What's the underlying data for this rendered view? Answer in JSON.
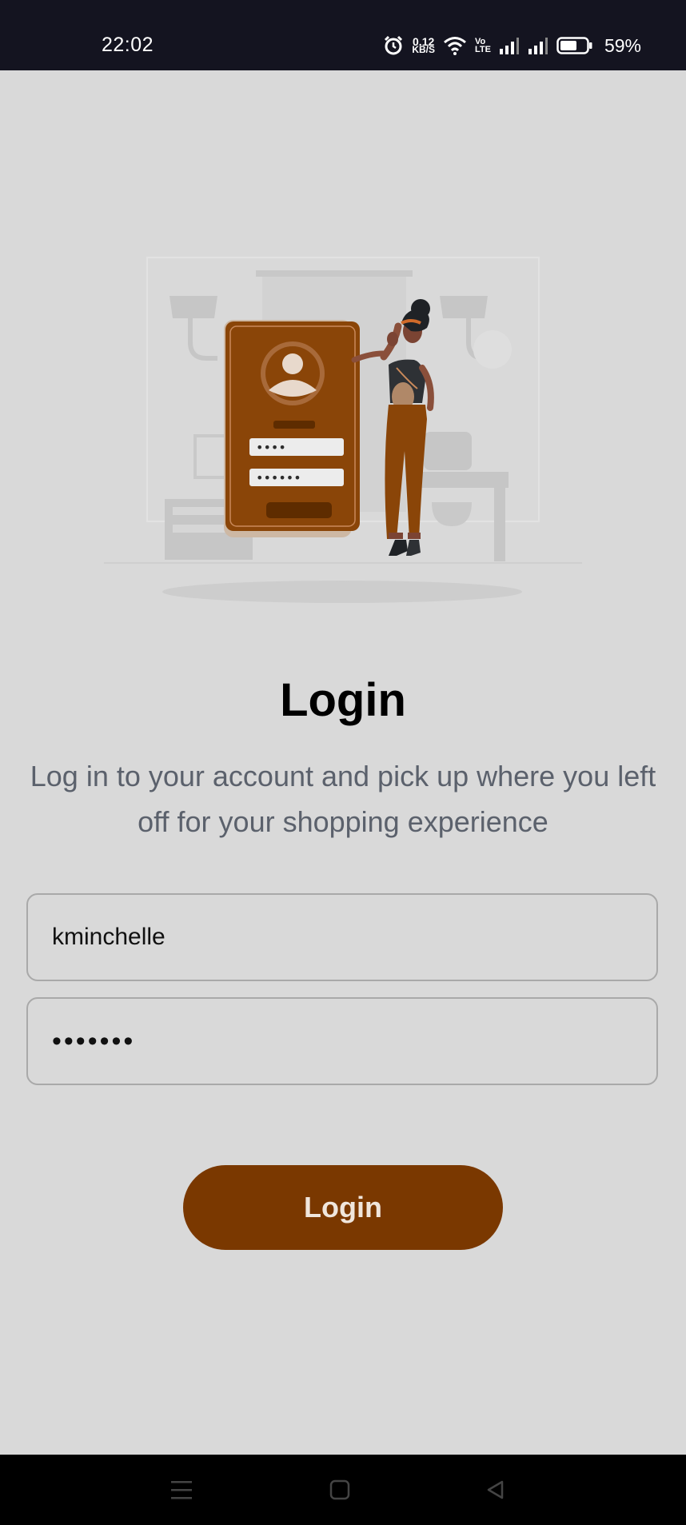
{
  "status_bar": {
    "time": "22:02",
    "net_speed_value": "0.12",
    "net_speed_unit": "KB/S",
    "volte_top": "Vo",
    "volte_bottom": "LTE",
    "battery_percent": "59%"
  },
  "login": {
    "title": "Login",
    "subtitle": "Log in to your account and pick up where you left off for your shopping experience",
    "username_value": "kminchelle",
    "password_value": "•••••••",
    "button_label": "Login"
  },
  "illustration": {
    "phone_field_1": "••••",
    "phone_field_2": "••••••"
  },
  "colors": {
    "accent": "#7a3800",
    "background": "#d9d9d9",
    "status_bar": "#141420"
  },
  "icons": {
    "status": [
      "alarm-icon",
      "wifi-icon",
      "signal-icon",
      "signal-icon",
      "battery-icon"
    ],
    "nav": [
      "menu-icon",
      "home-icon",
      "back-icon"
    ]
  }
}
